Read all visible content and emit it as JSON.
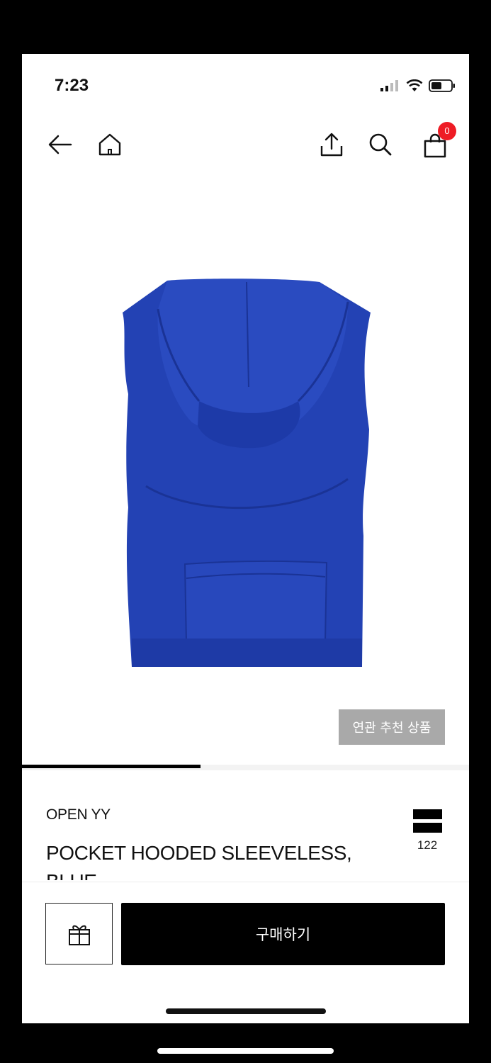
{
  "status_bar": {
    "time": "7:23"
  },
  "nav": {
    "cart_count": "0"
  },
  "product": {
    "related_label": "연관 추천 상품",
    "brand": "OPEN YY",
    "name": "POCKET HOODED SLEEVELESS, BLUE",
    "like_count": "122",
    "image_color": "#2342b4",
    "gallery_progress": 0.4
  },
  "actions": {
    "buy_label": "구매하기"
  },
  "colors": {
    "badge": "#ee1c25",
    "accent": "#000000",
    "related_button": "#a9a9a9"
  }
}
